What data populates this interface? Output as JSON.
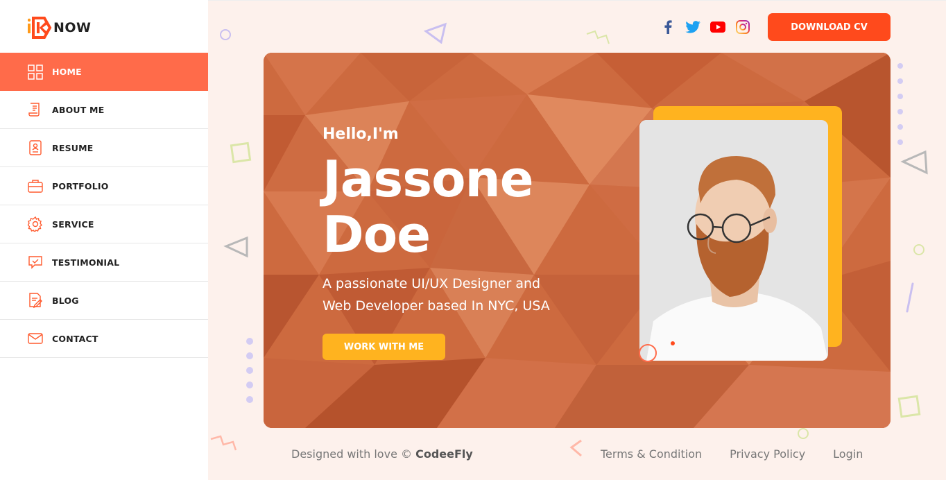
{
  "brand": {
    "logo_text": "NOW",
    "logo_prefix": "iK"
  },
  "sidebar": {
    "items": [
      {
        "label": "HOME",
        "icon": "grid-icon",
        "active": true
      },
      {
        "label": "ABOUT ME",
        "icon": "document-icon",
        "active": false
      },
      {
        "label": "RESUME",
        "icon": "profile-card-icon",
        "active": false
      },
      {
        "label": "PORTFOLIO",
        "icon": "briefcase-icon",
        "active": false
      },
      {
        "label": "SERVICE",
        "icon": "gear-icon",
        "active": false
      },
      {
        "label": "TESTIMONIAL",
        "icon": "chat-check-icon",
        "active": false
      },
      {
        "label": "BLOG",
        "icon": "pen-document-icon",
        "active": false
      },
      {
        "label": "CONTACT",
        "icon": "envelope-icon",
        "active": false
      }
    ]
  },
  "header": {
    "social": [
      "facebook-icon",
      "twitter-icon",
      "youtube-icon",
      "instagram-icon"
    ],
    "download_label": "DOWNLOAD CV"
  },
  "hero": {
    "greeting": "Hello,I'm",
    "name_first": "Jassone",
    "name_last": "Doe",
    "tagline": "A passionate UI/UX Designer and Web Developer based In NYC, USA",
    "cta_label": "WORK WITH ME"
  },
  "footer": {
    "credit_prefix": "Designed with love ©",
    "credit_brand": "CodeeFly",
    "links": [
      "Terms & Condition",
      "Privacy Policy",
      "Login"
    ]
  },
  "colors": {
    "accent": "#ff6b4a",
    "download": "#ff4a1c",
    "hero_bg": "#cf6a3e",
    "cta": "#ffb31f",
    "main_bg": "#fdf1ec"
  }
}
